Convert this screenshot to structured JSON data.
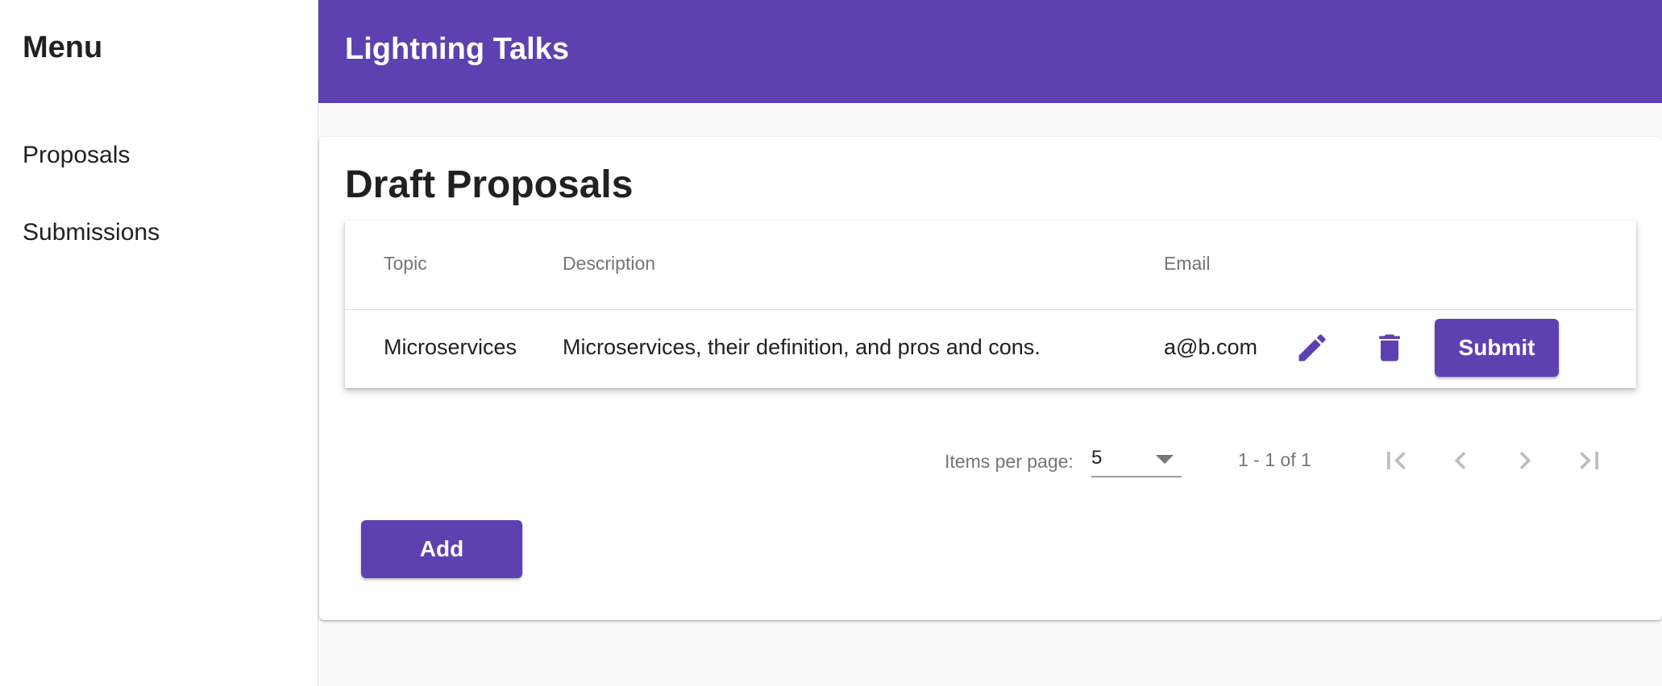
{
  "sidebar": {
    "title": "Menu",
    "items": [
      {
        "label": "Proposals"
      },
      {
        "label": "Submissions"
      }
    ]
  },
  "toolbar": {
    "title": "Lightning Talks"
  },
  "main": {
    "title": "Draft Proposals",
    "table": {
      "columns": [
        "Topic",
        "Description",
        "Email"
      ],
      "rows": [
        {
          "topic": "Microservices",
          "description": "Microservices, their definition, and pros and cons.",
          "email": "a@b.com",
          "edit_icon": "pencil-icon",
          "delete_icon": "trash-icon",
          "submit_label": "Submit"
        }
      ]
    },
    "paginator": {
      "items_per_page_label": "Items per page:",
      "page_size": "5",
      "range_label": "1 - 1 of 1",
      "icons": [
        "first-page-icon",
        "chevron-left-icon",
        "chevron-right-icon",
        "last-page-icon"
      ]
    },
    "add_label": "Add"
  },
  "colors": {
    "primary": "#5e41b0",
    "background": "#fafafa",
    "text": "#212121",
    "secondary_text": "#757575",
    "disabled_icon": "#bdbdbd"
  }
}
